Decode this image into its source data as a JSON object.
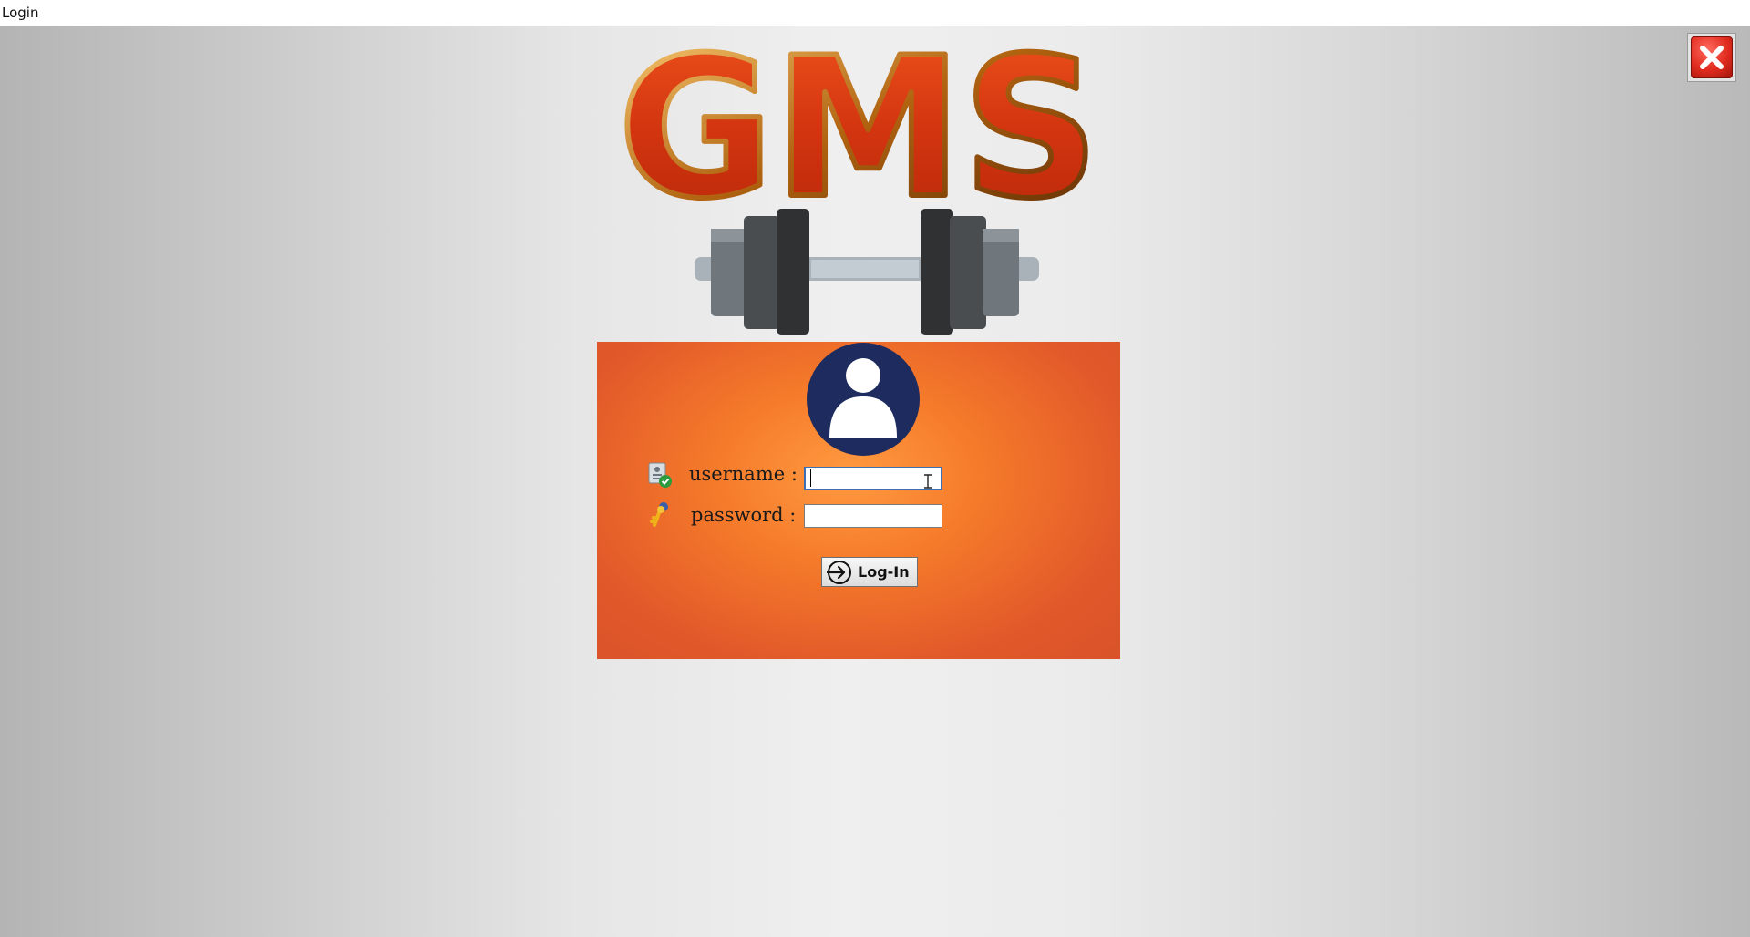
{
  "window": {
    "title": "Login"
  },
  "brand": {
    "logo_text": "GMS"
  },
  "login_form": {
    "username_label": "username :",
    "password_label": "password :",
    "username_value": "",
    "password_value": "",
    "login_button_label": "Log-In"
  },
  "icons": {
    "close": "close-icon",
    "avatar": "user-avatar-icon",
    "username": "user-id-card-icon",
    "password": "keys-icon",
    "login": "sign-in-arrow-icon",
    "dumbbell": "dumbbell-icon"
  },
  "colors": {
    "panel": "#f07a2e",
    "logo": "#d63a10",
    "avatar_bg": "#1d2b5e",
    "close": "#e12b1f"
  }
}
